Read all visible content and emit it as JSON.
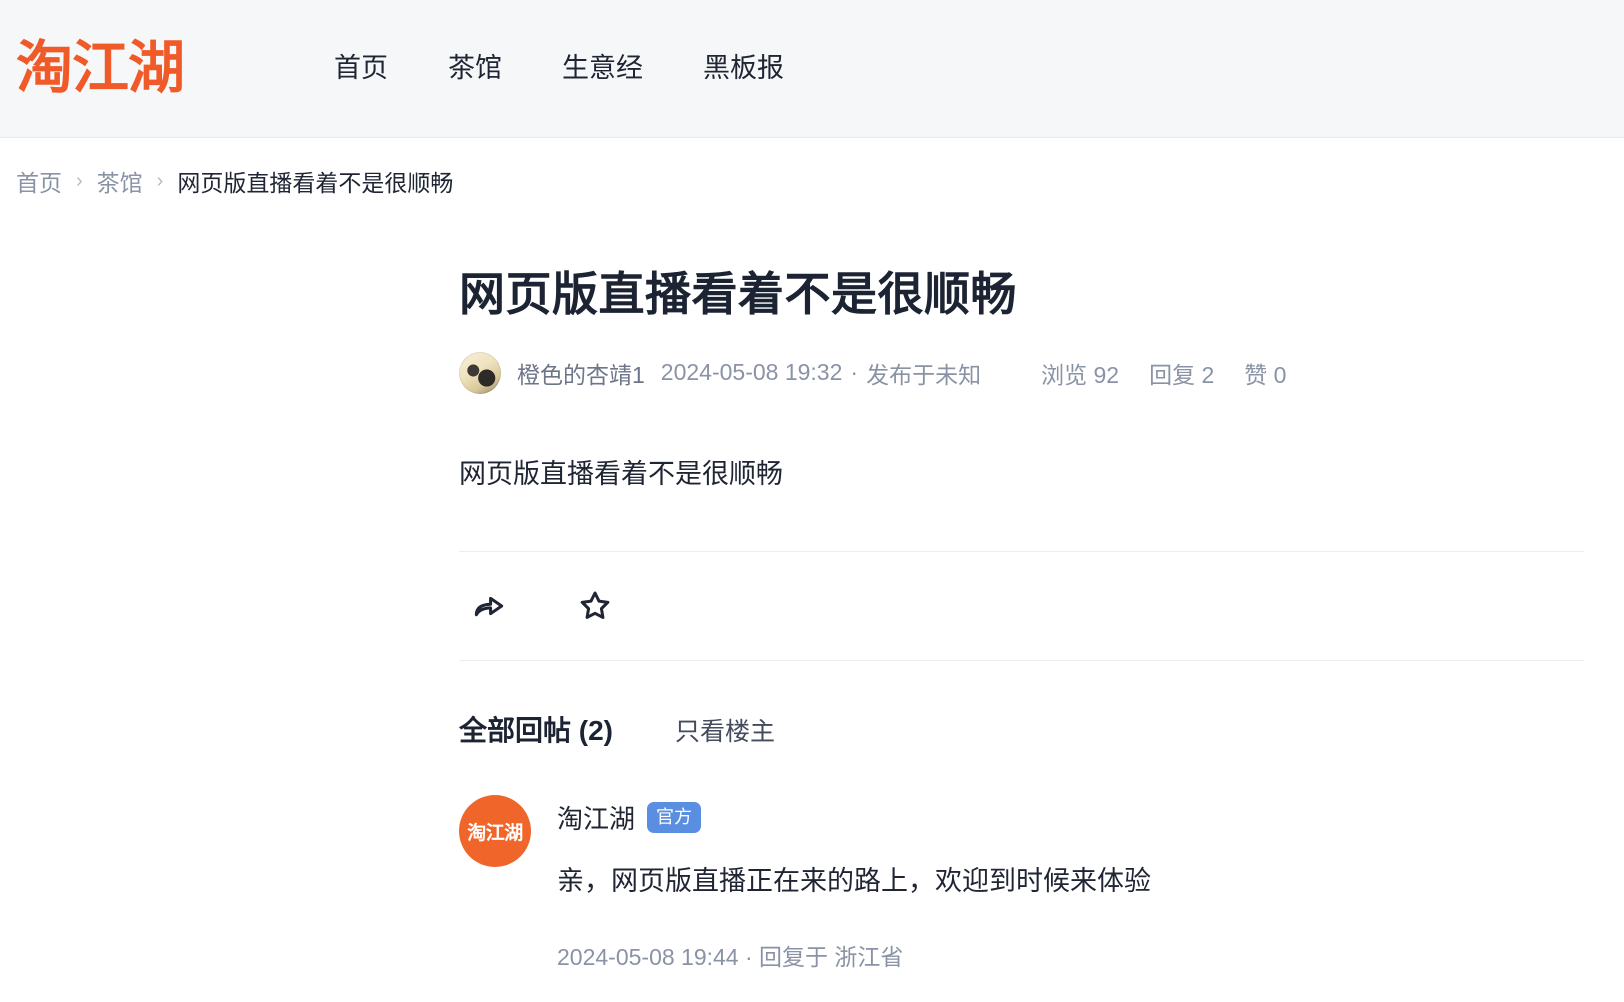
{
  "header": {
    "logo_text": "淘江湖",
    "nav": [
      {
        "label": "首页"
      },
      {
        "label": "茶馆"
      },
      {
        "label": "生意经"
      },
      {
        "label": "黑板报"
      }
    ]
  },
  "breadcrumb": {
    "home": "首页",
    "section": "茶馆",
    "separator": "›",
    "current": "网页版直播看着不是很顺畅"
  },
  "post": {
    "title": "网页版直播看着不是很顺畅",
    "author": "橙色的杏靖1",
    "time": "2024-05-08 19:32",
    "meta_dot": "·",
    "location": "发布于未知",
    "stats": [
      {
        "label": "浏览 92"
      },
      {
        "label": "回复 2"
      },
      {
        "label": "赞 0"
      }
    ],
    "body": "网页版直播看着不是很顺畅",
    "actions": [
      {
        "icon": "share-icon"
      },
      {
        "icon": "star-icon"
      }
    ]
  },
  "replies": {
    "title": "全部回帖 (2)",
    "filter_label": "只看楼主",
    "items": [
      {
        "avatar_text": "淘江湖",
        "author": "淘江湖",
        "badge": "官方",
        "text": "亲，网页版直播正在来的路上，欢迎到时候来体验",
        "footer": "2024-05-08 19:44 · 回复于 浙江省"
      }
    ]
  },
  "colors": {
    "brand_orange": "#f05a28",
    "badge_blue": "#5a8ee0",
    "text_dark": "#1f2533",
    "text_muted": "#8a93a5",
    "header_bg": "#f6f7f8"
  }
}
